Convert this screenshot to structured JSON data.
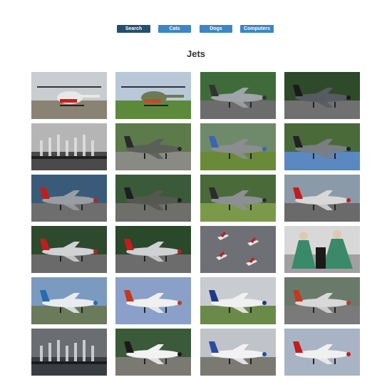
{
  "nav": {
    "buttons": [
      {
        "label": "Search",
        "color": "#24506b"
      },
      {
        "label": "Cats",
        "color": "#3e86c2"
      },
      {
        "label": "Dogs",
        "color": "#3e86c2"
      },
      {
        "label": "Computers",
        "color": "#3e86c2"
      }
    ]
  },
  "page": {
    "title": "Jets"
  },
  "gallery": {
    "images": [
      {
        "subject": "helicopter-red-white",
        "sky": "#c9ccd0",
        "ground": "#8a8272",
        "body": "#e8e8e8",
        "accent": "#cc1d1d"
      },
      {
        "subject": "helicopter-camo-mansion",
        "sky": "#b8c8d8",
        "ground": "#5c8a3a",
        "body": "#6d7a55",
        "accent": "#c24a2a"
      },
      {
        "subject": "jet-grey-nose-front",
        "sky": "#3f6b3a",
        "ground": "#6c6c6c",
        "body": "#9ea4a8",
        "accent": "#333333"
      },
      {
        "subject": "jet-grey-front-dark",
        "sky": "#2e4a2a",
        "ground": "#707070",
        "body": "#555b60",
        "accent": "#1a1a1a"
      },
      {
        "subject": "fountain-bw",
        "sky": "#b5b5b5",
        "ground": "#4a4a4a",
        "body": "#e0e0e0",
        "accent": "#202020"
      },
      {
        "subject": "jet-camo-side",
        "sky": "#5c7a4a",
        "ground": "#8a8a84",
        "body": "#5a5f58",
        "accent": "#2a2a2a"
      },
      {
        "subject": "jet-grey-low",
        "sky": "#6f8a6a",
        "ground": "#6a8a3a",
        "body": "#8a8e90",
        "accent": "#3a66b0"
      },
      {
        "subject": "jet-grey-front-runway",
        "sky": "#4a6a3a",
        "ground": "#5a88c0",
        "body": "#7a7e82",
        "accent": "#222222"
      },
      {
        "subject": "jet-grey-red-tail",
        "sky": "#3a5a7a",
        "ground": "#6e6e6e",
        "body": "#9a9ea2",
        "accent": "#c21d1d"
      },
      {
        "subject": "jet-dark-olive",
        "sky": "#3a5a3a",
        "ground": "#6e6e6a",
        "body": "#55584e",
        "accent": "#1e1e1e"
      },
      {
        "subject": "jet-grey-side-green",
        "sky": "#4a6a3a",
        "ground": "#7a9a4a",
        "body": "#8c9094",
        "accent": "#2c2c2c"
      },
      {
        "subject": "jet-red-tail-smoke",
        "sky": "#8a9aa8",
        "ground": "#6a6a6a",
        "body": "#d8d8d8",
        "accent": "#c21d1d"
      },
      {
        "subject": "jet-red-tail-front",
        "sky": "#2e4a2e",
        "ground": "#6a6a6a",
        "body": "#d0d2d4",
        "accent": "#c21d1d"
      },
      {
        "subject": "jet-red-tail-crew",
        "sky": "#2a482a",
        "ground": "#6c6c6c",
        "body": "#cfd1d3",
        "accent": "#c21d1d"
      },
      {
        "subject": "jets-formation-sky",
        "sky": "#6e7075",
        "ground": "#6e7075",
        "body": "#e8e8e8",
        "accent": "#c21d1d"
      },
      {
        "subject": "dancers-dresses",
        "sky": "#d8d8d8",
        "ground": "#a0a0a0",
        "body": "#3a8a6a",
        "accent": "#1a1a1a"
      },
      {
        "subject": "bizjet-blue-white",
        "sky": "#7a9ac0",
        "ground": "#6a7a5a",
        "body": "#e8ecf0",
        "accent": "#2a6ab0"
      },
      {
        "subject": "airliner-white-sky",
        "sky": "#8aa0c8",
        "ground": "#8aa0c8",
        "body": "#f0f0f0",
        "accent": "#c23a1d"
      },
      {
        "subject": "airliner-stripes",
        "sky": "#c8ccd0",
        "ground": "#6a8a4a",
        "body": "#f0f0f0",
        "accent": "#1d3a8a"
      },
      {
        "subject": "jet-red-orange-hangar",
        "sky": "#6a7a6a",
        "ground": "#7a7a7a",
        "body": "#d8d8d8",
        "accent": "#c23a1d"
      },
      {
        "subject": "fountain-dark-lake",
        "sky": "#6a6e72",
        "ground": "#3a3e42",
        "body": "#d8dcdf",
        "accent": "#1a1c1e"
      },
      {
        "subject": "airliner-tree-line",
        "sky": "#3a5a3a",
        "ground": "#7a7a72",
        "body": "#f2f2f2",
        "accent": "#1a1a1a"
      },
      {
        "subject": "airliner-blue-stripe",
        "sky": "#c0c4c8",
        "ground": "#7a7a72",
        "body": "#f2f2f4",
        "accent": "#2a4aa0"
      },
      {
        "subject": "airliner-red-cloudy",
        "sky": "#a8b4c4",
        "ground": "#a8b4c4",
        "body": "#f0f0f0",
        "accent": "#c21d1d"
      }
    ]
  }
}
